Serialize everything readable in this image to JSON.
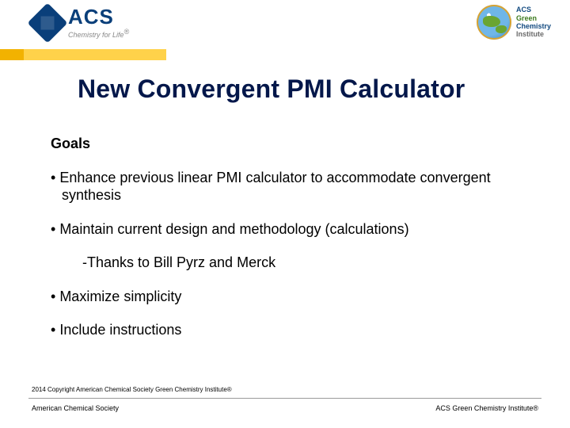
{
  "header": {
    "acs_logo_label": "ACS",
    "acs_tagline": "Chemistry for Life",
    "gci_line1": "ACS",
    "gci_line2": "Green",
    "gci_line3": "Chemistry",
    "gci_line4": "Institute"
  },
  "title": "New Convergent PMI Calculator",
  "body": {
    "goals_heading": "Goals",
    "bullets": [
      "Enhance previous linear PMI calculator to accommodate convergent synthesis",
      "Maintain current design and methodology (calculations)",
      "Maximize simplicity",
      "Include instructions"
    ],
    "subnote": "-Thanks to Bill Pyrz and Merck"
  },
  "footer": {
    "copyright": "2014 Copyright American Chemical Society Green Chemistry Institute®",
    "left": "American Chemical Society",
    "right": "ACS Green Chemistry Institute®"
  }
}
